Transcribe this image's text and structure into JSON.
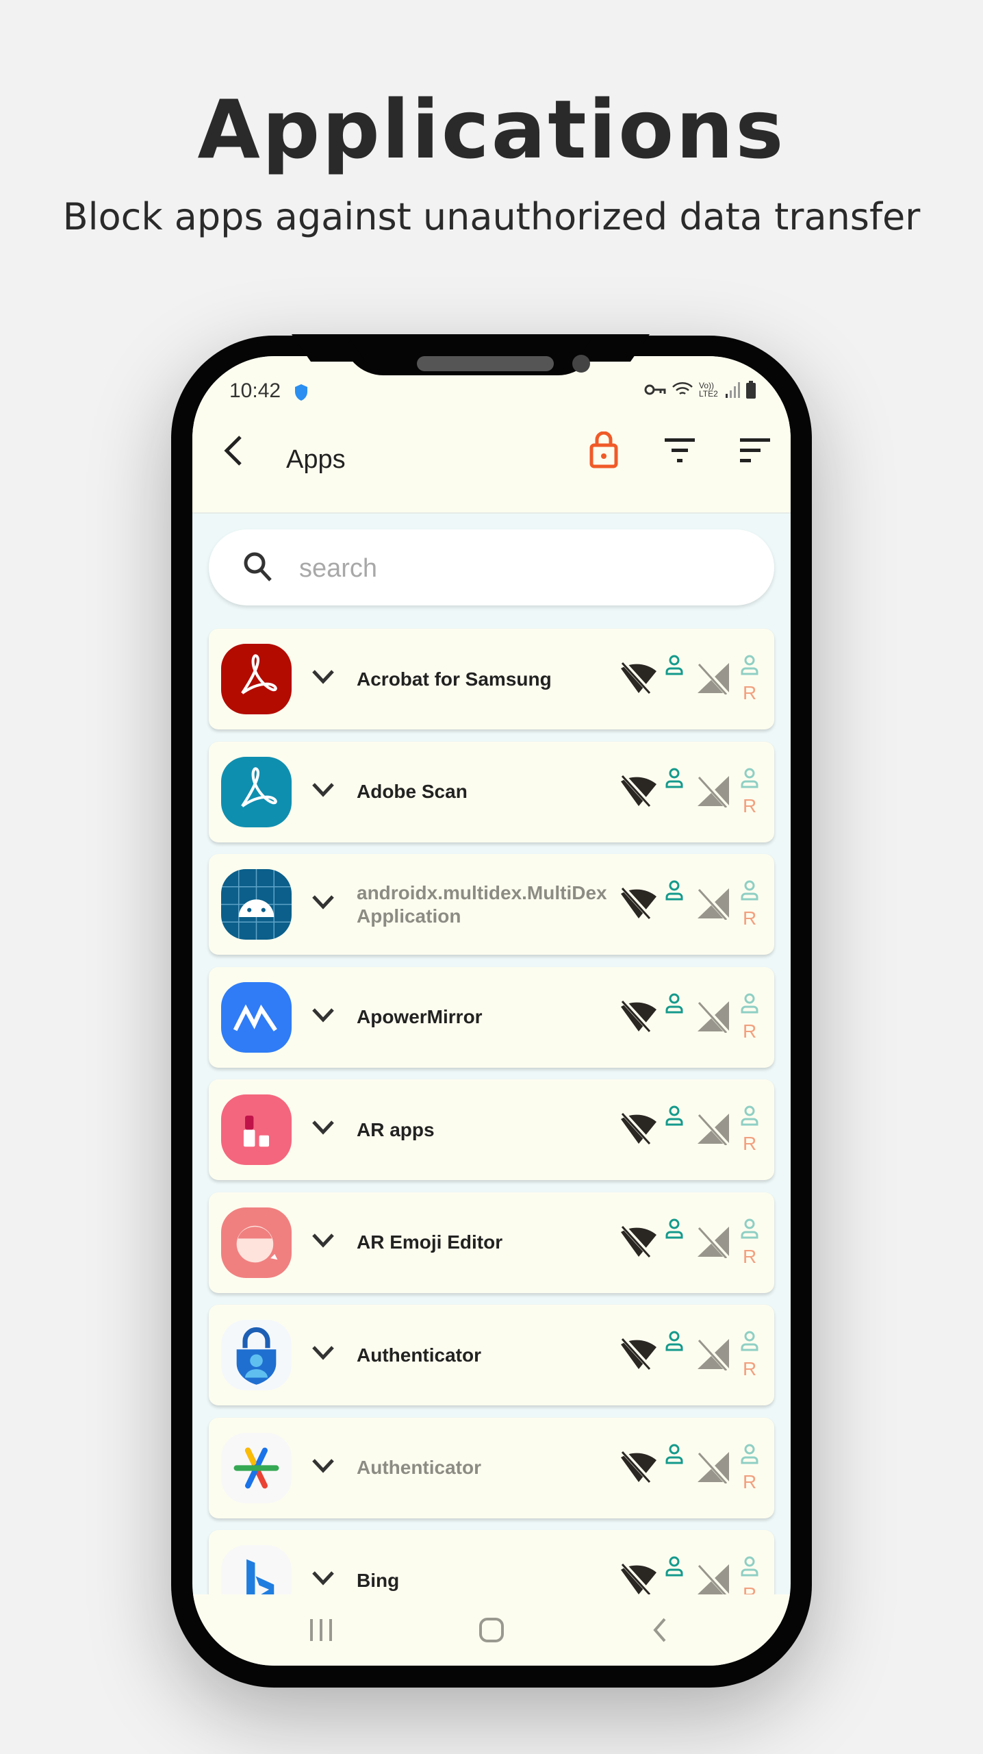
{
  "hero": {
    "title": "Applications",
    "subtitle": "Block apps against unauthorized data transfer"
  },
  "status_bar": {
    "time": "10:42",
    "network_label": "Vo)) LTE2"
  },
  "app_bar": {
    "title": "Apps",
    "lock_color": "#f05a28"
  },
  "search": {
    "placeholder": "search",
    "value": ""
  },
  "colors": {
    "background": "#fdfdef",
    "person_active": "#149a8c",
    "person_dim": "#8fcfc4",
    "r_label": "#f2a07f"
  },
  "apps": [
    {
      "name": "Acrobat for Samsung",
      "icon": "acrobat-icon",
      "dim": false,
      "r": "R"
    },
    {
      "name": "Adobe Scan",
      "icon": "adobe-scan-icon",
      "dim": false,
      "r": "R"
    },
    {
      "name": "androidx.multidex.MultiDexApplication",
      "icon": "android-icon",
      "dim": true,
      "r": "R"
    },
    {
      "name": "ApowerMirror",
      "icon": "apowermirror-icon",
      "dim": false,
      "r": "R"
    },
    {
      "name": "AR apps",
      "icon": "ar-apps-icon",
      "dim": false,
      "r": "R"
    },
    {
      "name": "AR Emoji Editor",
      "icon": "ar-emoji-icon",
      "dim": false,
      "r": "R"
    },
    {
      "name": "Authenticator",
      "icon": "microsoft-authenticator-icon",
      "dim": false,
      "r": "R"
    },
    {
      "name": "Authenticator",
      "icon": "google-authenticator-icon",
      "dim": true,
      "r": "R"
    },
    {
      "name": "Bing",
      "icon": "bing-icon",
      "dim": false,
      "r": "R"
    }
  ]
}
